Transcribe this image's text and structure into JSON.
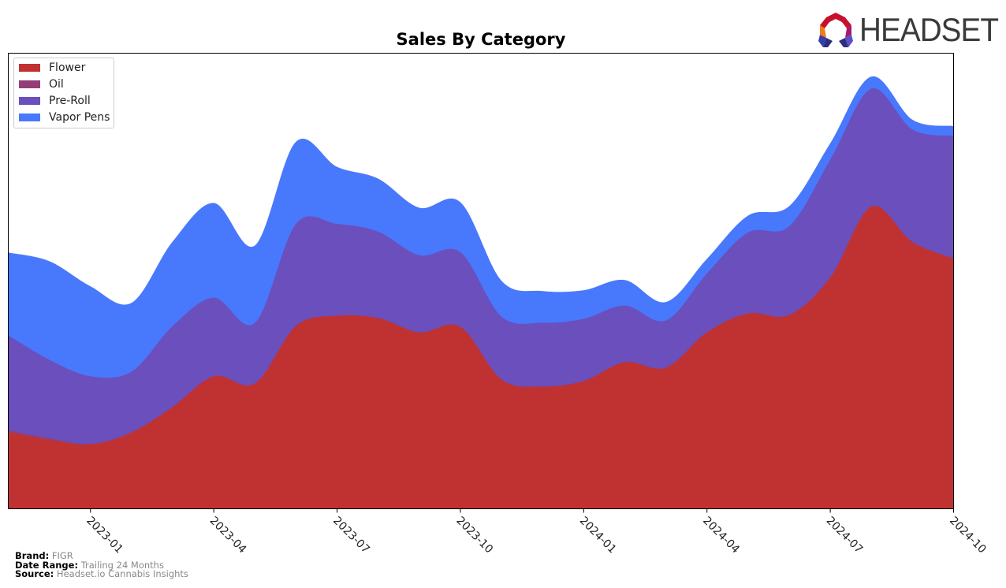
{
  "header": {
    "logo_text": "HEADSET"
  },
  "footer": {
    "brand_label": "Brand:",
    "brand_value": "FIGR",
    "date_range_label": "Date Range:",
    "date_range_value": "Trailing 24 Months",
    "source_label": "Source:",
    "source_value": "Headset.io Cannabis Insights"
  },
  "chart_data": {
    "type": "area",
    "stacked": true,
    "title": "Sales By Category",
    "xlabel": "",
    "ylabel": "",
    "y_units": "relative (no y-axis ticks shown)",
    "ylim": [
      0,
      580
    ],
    "grid": false,
    "legend_position": "top-left",
    "x": [
      "2022-11",
      "2022-12",
      "2023-01",
      "2023-02",
      "2023-03",
      "2023-04",
      "2023-05",
      "2023-06",
      "2023-07",
      "2023-08",
      "2023-09",
      "2023-10",
      "2023-11",
      "2023-12",
      "2024-01",
      "2024-02",
      "2024-03",
      "2024-04",
      "2024-05",
      "2024-06",
      "2024-07",
      "2024-08",
      "2024-09",
      "2024-10"
    ],
    "x_ticks": [
      "2023-01",
      "2023-04",
      "2023-07",
      "2023-10",
      "2024-01",
      "2024-04",
      "2024-07",
      "2024-10"
    ],
    "series": [
      {
        "name": "Flower",
        "color": "#c03232",
        "values": [
          98,
          88,
          82,
          97,
          130,
          169,
          160,
          233,
          246,
          243,
          225,
          232,
          165,
          156,
          163,
          187,
          180,
          225,
          249,
          247,
          295,
          385,
          340,
          319
        ]
      },
      {
        "name": "Oil",
        "color": "#943e78",
        "values": [
          2,
          2,
          1,
          1,
          0,
          0,
          0,
          0,
          0,
          0,
          0,
          0,
          0,
          0,
          0,
          0,
          0,
          0,
          0,
          0,
          0,
          0,
          0,
          0
        ]
      },
      {
        "name": "Pre-Roll",
        "color": "#6a4fbd",
        "values": [
          121,
          100,
          86,
          77,
          103,
          100,
          77,
          130,
          117,
          110,
          98,
          95,
          80,
          81,
          79,
          72,
          60,
          75,
          103,
          113,
          150,
          150,
          143,
          156
        ]
      },
      {
        "name": "Vapor Pens",
        "color": "#4878fc",
        "values": [
          105,
          125,
          114,
          87,
          107,
          120,
          98,
          104,
          72,
          67,
          60,
          63,
          45,
          40,
          36,
          32,
          23,
          18,
          21,
          25,
          20,
          15,
          12,
          12
        ]
      }
    ]
  }
}
